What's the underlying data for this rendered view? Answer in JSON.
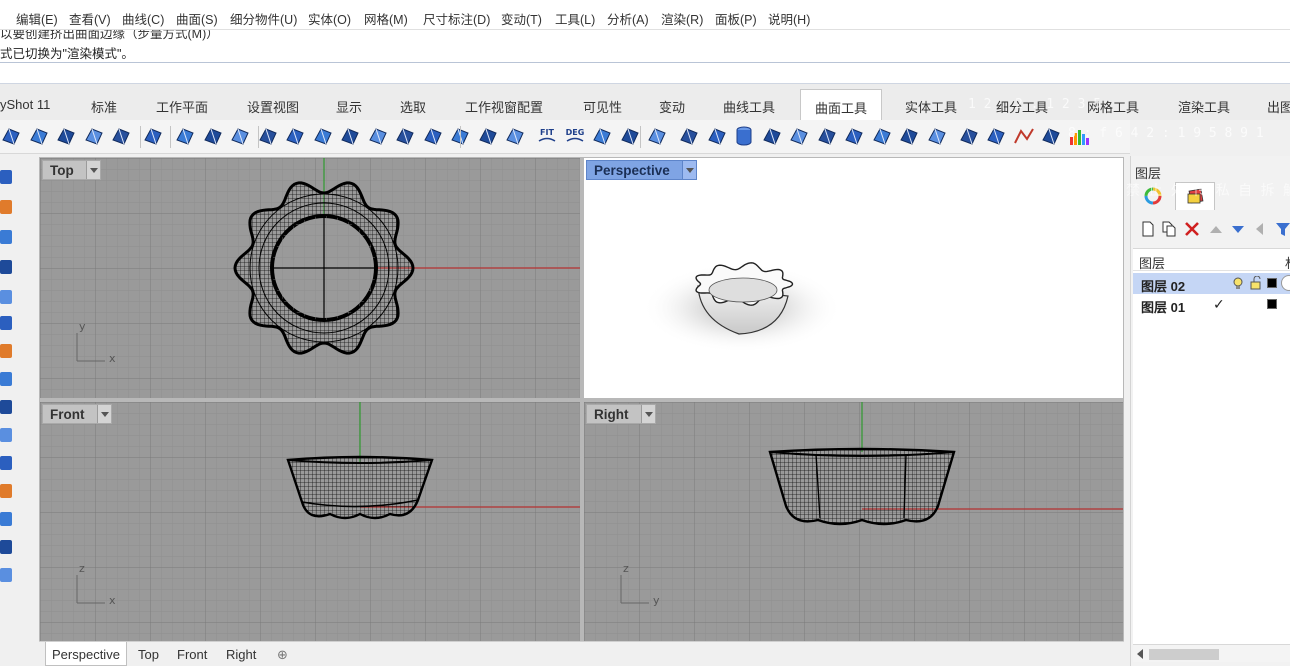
{
  "menu": [
    "编辑(E)",
    "查看(V)",
    "曲线(C)",
    "曲面(S)",
    "细分物件(U)",
    "实体(O)",
    "网格(M)",
    "尺寸标注(D)",
    "变动(T)",
    "工具(L)",
    "分析(A)",
    "渲染(R)",
    "面板(P)",
    "说明(H)"
  ],
  "command": {
    "prev_line": "以要创建挤出曲面边缘（步量方式(M)）",
    "last_line": "式已切换为\"渲染模式\"。"
  },
  "tabs": [
    "yShot 11",
    "标准",
    "工作平面",
    "设置视图",
    "显示",
    "选取",
    "工作视窗配置",
    "可见性",
    "变动",
    "曲线工具",
    "曲面工具",
    "实体工具",
    "细分工具",
    "网格工具",
    "渲染工具",
    "出图"
  ],
  "active_tab": "曲面工具",
  "toolbar_icons": [
    "surface-from-points-icon",
    "surface-from-curves-icon",
    "extrude-surface-icon",
    "loft-icon",
    "sweep-icon",
    "rail-revolve-icon",
    "blend-surface-icon",
    "patch-icon",
    "network-surface-icon",
    "offset-surface-icon",
    "fillet-surface-icon",
    "chamfer-surface-icon",
    "trim-icon",
    "split-icon",
    "untrim-icon",
    "rebuild-icon",
    "match-surface-icon",
    "merge-surface-icon",
    "unroll-icon",
    "fit-icon",
    "deg-icon",
    "set-point-icon",
    "move-uvn-icon",
    "frame-icon",
    "select-icon",
    "control-points-icon",
    "cylinder-icon",
    "cube-icon",
    "cone-icon",
    "plane-icon",
    "twist-icon",
    "bend-icon",
    "mirror-icon",
    "paint-icon",
    "zebra-icon",
    "box-analysis-icon",
    "curvature-icon",
    "grid-icon",
    "histogram-icon"
  ],
  "toolbar_labels": {
    "fit": "FIT",
    "deg": "DEG"
  },
  "viewports": [
    {
      "name": "Top",
      "axis_h": "x",
      "axis_v": "y",
      "active": false
    },
    {
      "name": "Perspective",
      "active": true
    },
    {
      "name": "Front",
      "axis_h": "x",
      "axis_v": "z",
      "active": false
    },
    {
      "name": "Right",
      "axis_h": "y",
      "axis_v": "z",
      "active": false
    }
  ],
  "bottom_tabs": [
    "Perspective",
    "Top",
    "Front",
    "Right"
  ],
  "active_bottom_tab": "Perspective",
  "add_viewport_glyph": "⊕",
  "panel": {
    "title": "图层",
    "list_header": "图层",
    "list_header_extra": "材",
    "layers": [
      {
        "name": "图层 02",
        "selected": true,
        "checked": false,
        "color": "#000000"
      },
      {
        "name": "图层 01",
        "selected": false,
        "checked": true,
        "color": "#000000"
      }
    ],
    "checkmark": "✓"
  },
  "watermark": {
    "line1": "1 2 . 2 . 1 2 3 5",
    "line2": "8 : f 6 4 2 : 1 9 5 8 9 1",
    "line3": "禁 止 外 传 私 自 拆 解"
  },
  "colors": {
    "grid_bg": "#9a9a9a",
    "x_axis": "#b53232",
    "y_axis": "#2f9a2f",
    "active_label": "#7fa4e4",
    "selected_layer": "#c5d6f5"
  }
}
